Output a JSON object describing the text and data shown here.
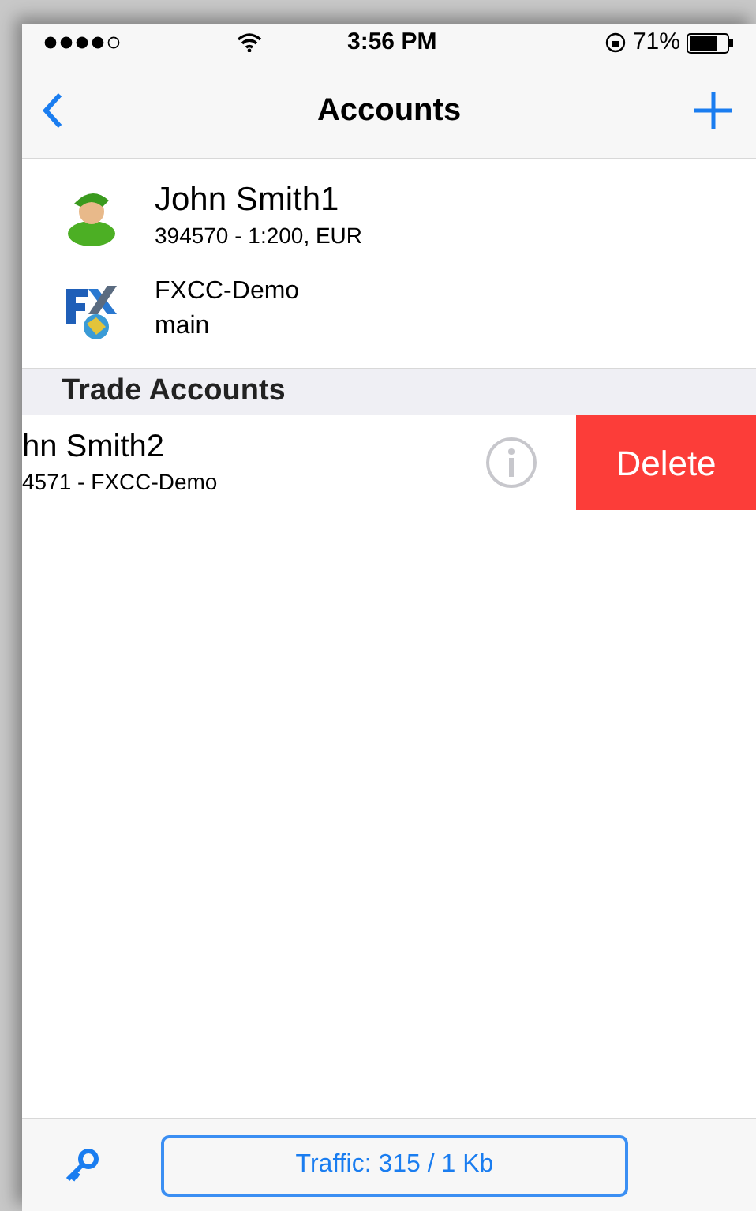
{
  "status_bar": {
    "time": "3:56 PM",
    "battery": "71%"
  },
  "nav": {
    "title": "Accounts"
  },
  "accounts": [
    {
      "kind": "user",
      "title": "John Smith1",
      "subtitle": "394570 - 1:200, EUR"
    },
    {
      "kind": "broker",
      "title": "FXCC-Demo",
      "subtitle": "main"
    }
  ],
  "section": {
    "title": "Trade Accounts"
  },
  "trade_rows": [
    {
      "title": "hn Smith2",
      "subtitle": "4571 - FXCC-Demo",
      "action": "Delete"
    }
  ],
  "toolbar": {
    "traffic": "Traffic: 315 / 1 Kb"
  }
}
